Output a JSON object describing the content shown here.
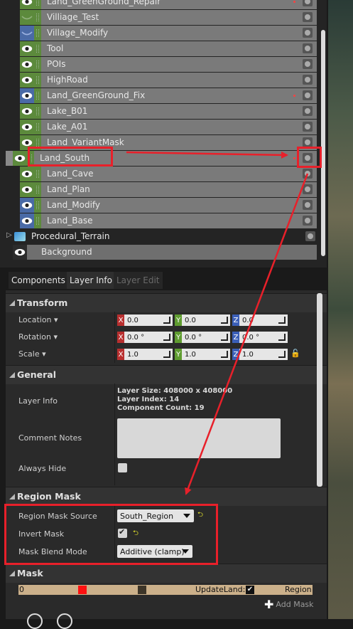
{
  "layers": [
    {
      "name": "Land_GreenGround_Repair",
      "eye": "green",
      "red_dot": true
    },
    {
      "name": "Villiage_Test",
      "eye": "green-dim",
      "red_dot": false
    },
    {
      "name": "Village_Modify",
      "eye": "blue-dim",
      "red_dot": false
    },
    {
      "name": "Tool",
      "eye": "green",
      "red_dot": false
    },
    {
      "name": "POIs",
      "eye": "green",
      "red_dot": false
    },
    {
      "name": "HighRoad",
      "eye": "green",
      "red_dot": false
    },
    {
      "name": "Land_GreenGround_Fix",
      "eye": "blue",
      "red_dot": true
    },
    {
      "name": "Lake_B01",
      "eye": "green",
      "red_dot": false
    },
    {
      "name": "Lake_A01",
      "eye": "green",
      "red_dot": false
    },
    {
      "name": "Land_VariantMask",
      "eye": "green",
      "red_dot": false
    },
    {
      "name": "Land_South",
      "eye": "green",
      "red_dot": true,
      "selected": true
    },
    {
      "name": "Land_Cave",
      "eye": "green",
      "red_dot": false
    },
    {
      "name": "Land_Plan",
      "eye": "green",
      "red_dot": false
    },
    {
      "name": "Land_Modify",
      "eye": "blue",
      "red_dot": false
    },
    {
      "name": "Land_Base",
      "eye": "blue",
      "red_dot": false
    }
  ],
  "procedural": {
    "name": "Procedural_Terrain"
  },
  "background": {
    "name": "Background"
  },
  "tabs": {
    "components": "Components",
    "layer_info": "Layer Info",
    "layer_edit": "Layer Edit"
  },
  "transform": {
    "title": "Transform",
    "location": {
      "label": "Location",
      "x": "0.0",
      "y": "0.0",
      "z": "0.0"
    },
    "rotation": {
      "label": "Rotation",
      "x": "0.0 °",
      "y": "0.0 °",
      "z": "0.0 °"
    },
    "scale": {
      "label": "Scale",
      "x": "1.0",
      "y": "1.0",
      "z": "1.0"
    },
    "axes": {
      "x": "X",
      "y": "Y",
      "z": "Z"
    }
  },
  "general": {
    "title": "General",
    "layer_info_label": "Layer Info",
    "layer_size": "Layer Size: 408000 x 408000",
    "layer_index": "Layer Index: 14",
    "component_count": "Component Count: 19",
    "comment_label": "Comment Notes",
    "always_hide_label": "Always Hide"
  },
  "region_mask": {
    "title": "Region Mask",
    "source_label": "Region Mask Source",
    "source_value": "South_Region",
    "invert_label": "Invert Mask",
    "blend_label": "Mask Blend Mode",
    "blend_value": "Additive (clamp)"
  },
  "mask": {
    "title": "Mask",
    "start_value": "0",
    "update_label": "UpdateLand:",
    "region_label": "Region",
    "add_label": "Add Mask"
  },
  "colors": {
    "highlight": "#e8202a",
    "eye_green": "#5c8a3c",
    "eye_blue": "#4a6aa6"
  }
}
